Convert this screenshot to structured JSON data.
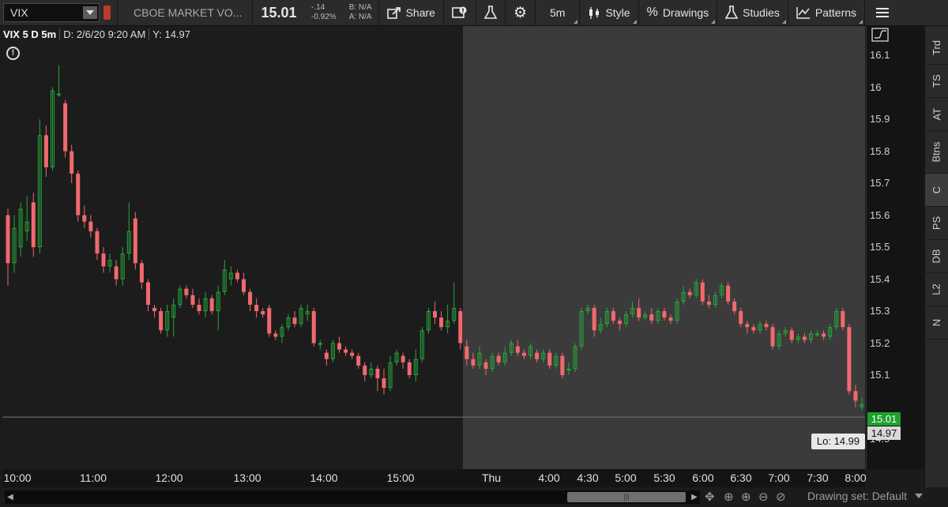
{
  "toolbar": {
    "symbol": "VIX",
    "description": "CBOE MARKET VO...",
    "last_price": "15.01",
    "net_change": "-.14",
    "pct_change": "-0.92%",
    "bid": "B: N/A",
    "ask": "A: N/A",
    "share_label": "Share",
    "timeframe_label": "5m",
    "style_label": "Style",
    "drawings_label": "Drawings",
    "studies_label": "Studies",
    "patterns_label": "Patterns"
  },
  "chart_header": {
    "title": "VIX 5 D 5m",
    "date": "D: 2/6/20 9:20 AM",
    "y_value": "Y: 14.97"
  },
  "price_axis": {
    "ticks": [
      "16.1",
      "16",
      "15.9",
      "15.8",
      "15.7",
      "15.6",
      "15.5",
      "15.4",
      "15.3",
      "15.2",
      "15.1",
      "14.9"
    ],
    "current_price": "15.01",
    "low_marker": "14.97",
    "low_label": "Lo: 14.99"
  },
  "time_axis": {
    "ticks": [
      "10:00",
      "11:00",
      "12:00",
      "13:00",
      "14:00",
      "15:00",
      "Thu",
      "4:00",
      "4:30",
      "5:00",
      "5:30",
      "6:00",
      "6:30",
      "7:00",
      "7:30",
      "8:00"
    ]
  },
  "bottom_bar": {
    "drawing_set": "Drawing set: Default"
  },
  "sidebar": {
    "tabs": [
      "Trd",
      "TS",
      "AT",
      "Btns",
      "C",
      "PS",
      "DB",
      "L2",
      "N"
    ],
    "active": "C"
  },
  "colors": {
    "up": "#27a83a",
    "down": "#f0696e",
    "extended_hours_bg": "#3b3b3b",
    "regular_bg": "#1c1c1c",
    "current_price_bg": "#1fa02e"
  },
  "chart_data": {
    "type": "candlestick",
    "ylim": [
      14.87,
      16.18
    ],
    "sessions": [
      "regular",
      "extended"
    ],
    "candles": [
      [
        15.6,
        15.45,
        15.62,
        15.38
      ],
      [
        15.45,
        15.56,
        15.6,
        15.42
      ],
      [
        15.5,
        15.62,
        15.64,
        15.47
      ],
      [
        15.55,
        15.58,
        15.66,
        15.52
      ],
      [
        15.64,
        15.5,
        15.67,
        15.47
      ],
      [
        15.5,
        15.85,
        15.9,
        15.48
      ],
      [
        15.85,
        15.75,
        15.88,
        15.72
      ],
      [
        15.75,
        15.99,
        16.0,
        15.74
      ],
      [
        15.98,
        15.98,
        16.07,
        15.97
      ],
      [
        15.95,
        15.8,
        15.96,
        15.78
      ],
      [
        15.8,
        15.73,
        15.82,
        15.7
      ],
      [
        15.73,
        15.6,
        15.74,
        15.58
      ],
      [
        15.6,
        15.58,
        15.63,
        15.56
      ],
      [
        15.58,
        15.55,
        15.6,
        15.53
      ],
      [
        15.55,
        15.48,
        15.56,
        15.46
      ],
      [
        15.48,
        15.44,
        15.5,
        15.42
      ],
      [
        15.44,
        15.46,
        15.48,
        15.42
      ],
      [
        15.44,
        15.4,
        15.46,
        15.38
      ],
      [
        15.4,
        15.48,
        15.5,
        15.38
      ],
      [
        15.48,
        15.55,
        15.64,
        15.46
      ],
      [
        15.59,
        15.45,
        15.61,
        15.43
      ],
      [
        15.45,
        15.39,
        15.46,
        15.37
      ],
      [
        15.39,
        15.32,
        15.4,
        15.3
      ],
      [
        15.31,
        15.3,
        15.32,
        15.28
      ],
      [
        15.3,
        15.24,
        15.31,
        15.23
      ],
      [
        15.24,
        15.3,
        15.32,
        15.22
      ],
      [
        15.28,
        15.32,
        15.34,
        15.22
      ],
      [
        15.32,
        15.37,
        15.38,
        15.31
      ],
      [
        15.37,
        15.35,
        15.38,
        15.34
      ],
      [
        15.35,
        15.32,
        15.37,
        15.31
      ],
      [
        15.32,
        15.3,
        15.34,
        15.29
      ],
      [
        15.3,
        15.34,
        15.36,
        15.28
      ],
      [
        15.34,
        15.3,
        15.35,
        15.29
      ],
      [
        15.3,
        15.36,
        15.38,
        15.24
      ],
      [
        15.36,
        15.43,
        15.46,
        15.35
      ],
      [
        15.4,
        15.42,
        15.44,
        15.38
      ],
      [
        15.42,
        15.4,
        15.43,
        15.39
      ],
      [
        15.4,
        15.36,
        15.42,
        15.35
      ],
      [
        15.36,
        15.32,
        15.37,
        15.3
      ],
      [
        15.32,
        15.3,
        15.34,
        15.28
      ],
      [
        15.3,
        15.29,
        15.31,
        15.28
      ],
      [
        15.31,
        15.23,
        15.32,
        15.22
      ],
      [
        15.23,
        15.22,
        15.24,
        15.21
      ],
      [
        15.22,
        15.25,
        15.26,
        15.2
      ],
      [
        15.25,
        15.28,
        15.29,
        15.24
      ],
      [
        15.28,
        15.26,
        15.3,
        15.25
      ],
      [
        15.26,
        15.31,
        15.32,
        15.25
      ],
      [
        15.29,
        15.3,
        15.32,
        15.27
      ],
      [
        15.3,
        15.2,
        15.31,
        15.19
      ],
      [
        15.2,
        15.2,
        15.21,
        15.18
      ],
      [
        15.17,
        15.15,
        15.18,
        15.13
      ],
      [
        15.15,
        15.2,
        15.21,
        15.14
      ],
      [
        15.2,
        15.18,
        15.22,
        15.17
      ],
      [
        15.18,
        15.17,
        15.19,
        15.16
      ],
      [
        15.17,
        15.16,
        15.18,
        15.15
      ],
      [
        15.16,
        15.13,
        15.17,
        15.12
      ],
      [
        15.13,
        15.1,
        15.14,
        15.08
      ],
      [
        15.1,
        15.12,
        15.14,
        15.09
      ],
      [
        15.12,
        15.09,
        15.13,
        15.05
      ],
      [
        15.09,
        15.06,
        15.12,
        15.04
      ],
      [
        15.06,
        15.14,
        15.16,
        15.05
      ],
      [
        15.14,
        15.17,
        15.18,
        15.13
      ],
      [
        15.16,
        15.14,
        15.17,
        15.12
      ],
      [
        15.14,
        15.1,
        15.15,
        15.09
      ],
      [
        15.1,
        15.15,
        15.18,
        15.08
      ],
      [
        15.15,
        15.24,
        15.25,
        15.14
      ],
      [
        15.24,
        15.3,
        15.31,
        15.23
      ],
      [
        15.3,
        15.28,
        15.33,
        15.26
      ],
      [
        15.28,
        15.25,
        15.3,
        15.24
      ],
      [
        15.25,
        15.27,
        15.32,
        15.23
      ],
      [
        15.27,
        15.31,
        15.39,
        15.26
      ],
      [
        15.3,
        15.2,
        15.31,
        15.18
      ],
      [
        15.19,
        15.15,
        15.21,
        15.13
      ],
      [
        15.15,
        15.13,
        15.17,
        15.12
      ],
      [
        15.13,
        15.17,
        15.19,
        15.12
      ],
      [
        15.14,
        15.12,
        15.15,
        15.1
      ],
      [
        15.12,
        15.16,
        15.17,
        15.11
      ],
      [
        15.16,
        15.14,
        15.17,
        15.13
      ],
      [
        15.14,
        15.17,
        15.19,
        15.13
      ],
      [
        15.17,
        15.2,
        15.21,
        15.16
      ],
      [
        15.19,
        15.17,
        15.21,
        15.16
      ],
      [
        15.17,
        15.16,
        15.18,
        15.15
      ],
      [
        15.16,
        15.19,
        15.2,
        15.15
      ],
      [
        15.17,
        15.15,
        15.18,
        15.14
      ],
      [
        15.15,
        15.17,
        15.18,
        15.14
      ],
      [
        15.17,
        15.13,
        15.18,
        15.12
      ],
      [
        15.13,
        15.16,
        15.17,
        15.12
      ],
      [
        15.16,
        15.1,
        15.17,
        15.09
      ],
      [
        15.12,
        15.12,
        15.14,
        15.1
      ],
      [
        15.12,
        15.19,
        15.2,
        15.11
      ],
      [
        15.19,
        15.3,
        15.31,
        15.18
      ],
      [
        15.3,
        15.31,
        15.32,
        15.29
      ],
      [
        15.31,
        15.24,
        15.32,
        15.22
      ],
      [
        15.24,
        15.26,
        15.28,
        15.23
      ],
      [
        15.26,
        15.3,
        15.31,
        15.25
      ],
      [
        15.3,
        15.27,
        15.31,
        15.26
      ],
      [
        15.27,
        15.26,
        15.28,
        15.24
      ],
      [
        15.26,
        15.29,
        15.3,
        15.25
      ],
      [
        15.29,
        15.31,
        15.33,
        15.28
      ],
      [
        15.31,
        15.28,
        15.34,
        15.27
      ],
      [
        15.28,
        15.29,
        15.3,
        15.27
      ],
      [
        15.29,
        15.27,
        15.31,
        15.26
      ],
      [
        15.27,
        15.3,
        15.31,
        15.26
      ],
      [
        15.3,
        15.28,
        15.31,
        15.27
      ],
      [
        15.28,
        15.27,
        15.29,
        15.26
      ],
      [
        15.27,
        15.33,
        15.34,
        15.26
      ],
      [
        15.33,
        15.36,
        15.38,
        15.32
      ],
      [
        15.36,
        15.35,
        15.37,
        15.34
      ],
      [
        15.35,
        15.39,
        15.4,
        15.34
      ],
      [
        15.39,
        15.33,
        15.4,
        15.32
      ],
      [
        15.33,
        15.32,
        15.35,
        15.31
      ],
      [
        15.32,
        15.35,
        15.36,
        15.31
      ],
      [
        15.35,
        15.38,
        15.39,
        15.34
      ],
      [
        15.38,
        15.33,
        15.39,
        15.32
      ],
      [
        15.33,
        15.3,
        15.34,
        15.29
      ],
      [
        15.3,
        15.26,
        15.31,
        15.25
      ],
      [
        15.26,
        15.25,
        15.27,
        15.23
      ],
      [
        15.25,
        15.24,
        15.26,
        15.23
      ],
      [
        15.24,
        15.26,
        15.27,
        15.23
      ],
      [
        15.26,
        15.25,
        15.27,
        15.24
      ],
      [
        15.25,
        15.19,
        15.26,
        15.18
      ],
      [
        15.19,
        15.23,
        15.24,
        15.18
      ],
      [
        15.23,
        15.24,
        15.25,
        15.22
      ],
      [
        15.24,
        15.21,
        15.25,
        15.2
      ],
      [
        15.21,
        15.22,
        15.23,
        15.2
      ],
      [
        15.22,
        15.21,
        15.23,
        15.2
      ],
      [
        15.21,
        15.23,
        15.24,
        15.2
      ],
      [
        15.23,
        15.23,
        15.24,
        15.22
      ],
      [
        15.23,
        15.22,
        15.24,
        15.21
      ],
      [
        15.22,
        15.25,
        15.26,
        15.21
      ],
      [
        15.25,
        15.3,
        15.31,
        15.24
      ],
      [
        15.3,
        15.25,
        15.31,
        15.24
      ],
      [
        15.25,
        15.05,
        15.26,
        15.04
      ],
      [
        15.05,
        15.02,
        15.07,
        15.0
      ],
      [
        15.0,
        15.01,
        15.03,
        14.99
      ]
    ]
  }
}
